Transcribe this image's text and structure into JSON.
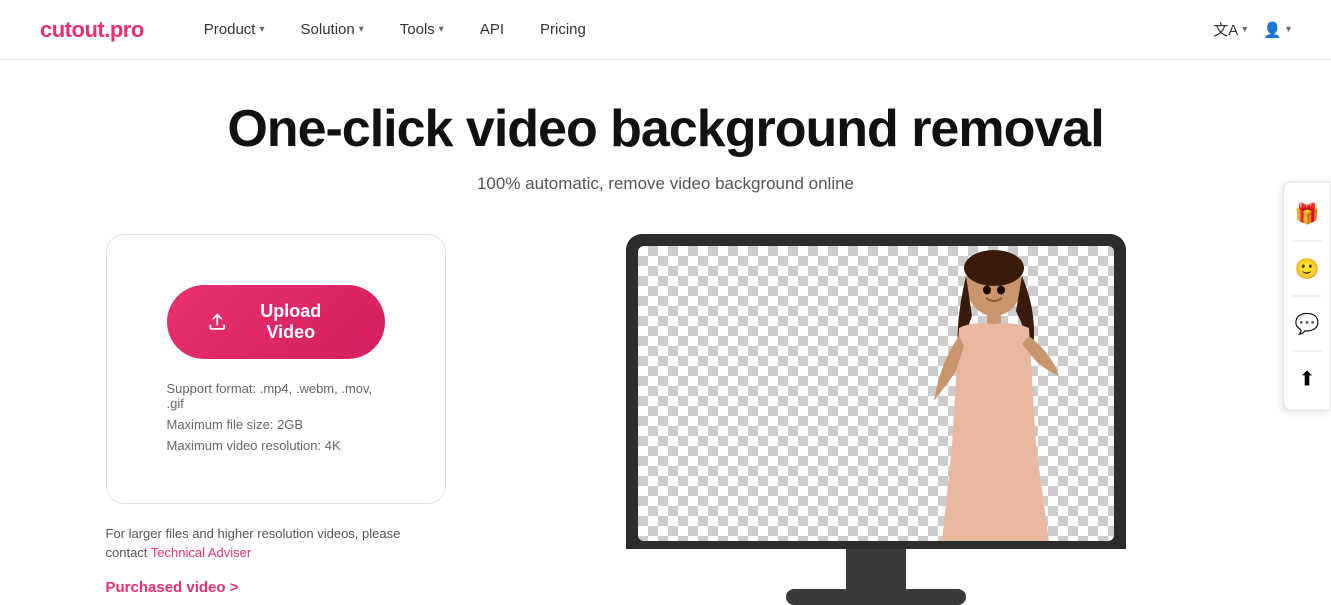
{
  "logo": {
    "text_cutout": "cutout",
    "text_dot": ".",
    "text_pro": "pro"
  },
  "nav": {
    "product_label": "Product",
    "solution_label": "Solution",
    "tools_label": "Tools",
    "api_label": "API",
    "pricing_label": "Pricing",
    "lang_label": "文A",
    "user_icon_label": "👤"
  },
  "hero": {
    "title": "One-click video background removal",
    "subtitle": "100% automatic, remove video background online"
  },
  "upload": {
    "button_label": "Upload Video",
    "spec1": "Support format: .mp4, .webm, .mov, .gif",
    "spec2": "Maximum file size: 2GB",
    "spec3": "Maximum video resolution: 4K",
    "adviser_text": "For larger files and higher resolution videos, please contact ",
    "adviser_link_text": "Technical Adviser",
    "purchased_label": "Purchased video >"
  },
  "sidebar": {
    "gift_icon": "🎁",
    "face_icon": "🙂",
    "feedback_icon": "💬",
    "upload_icon": "⬆"
  },
  "colors": {
    "primary": "#e8306e",
    "dark": "#2d2d2d"
  }
}
